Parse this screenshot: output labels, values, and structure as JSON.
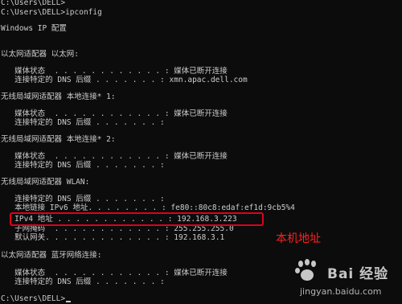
{
  "terminal": {
    "lines": [
      "C:\\Users\\DELL>",
      "C:\\Users\\DELL>ipconfig",
      "",
      "Windows IP 配置",
      "",
      "",
      "以太网适配器 以太网:",
      "",
      "   媒体状态  . . . . . . . . . . . . : 媒体已断开连接",
      "   连接特定的 DNS 后缀 . . . . . . . : xmn.apac.dell.com",
      "",
      "无线局域网适配器 本地连接* 1:",
      "",
      "   媒体状态  . . . . . . . . . . . . : 媒体已断开连接",
      "   连接特定的 DNS 后缀 . . . . . . . :",
      "",
      "无线局域网适配器 本地连接* 2:",
      "",
      "   媒体状态  . . . . . . . . . . . . : 媒体已断开连接",
      "   连接特定的 DNS 后缀 . . . . . . . :",
      "",
      "无线局域网适配器 WLAN:",
      "",
      "   连接特定的 DNS 后缀 . . . . . . . :",
      "   本地链接 IPv6 地址. . . . . . . . : fe80::80c8:edaf:ef1d:9cb5%4",
      "   IPv4 地址 . . . . . . . . . . . . : 192.168.3.223",
      "   子网掩码  . . . . . . . . . . . . : 255.255.255.0",
      "   默认网关. . . . . . . . . . . . . : 192.168.3.1",
      "",
      "以太网适配器 蓝牙网络连接:",
      "",
      "   媒体状态  . . . . . . . . . . . . : 媒体已断开连接",
      "   连接特定的 DNS 后缀 . . . . . . . :",
      "",
      "C:\\Users\\DELL>"
    ]
  },
  "annotation": {
    "label": "本机地址",
    "color": "#ff2020"
  },
  "watermark": {
    "title": "Bai 经验",
    "url": "jingyan.baidu.com"
  }
}
